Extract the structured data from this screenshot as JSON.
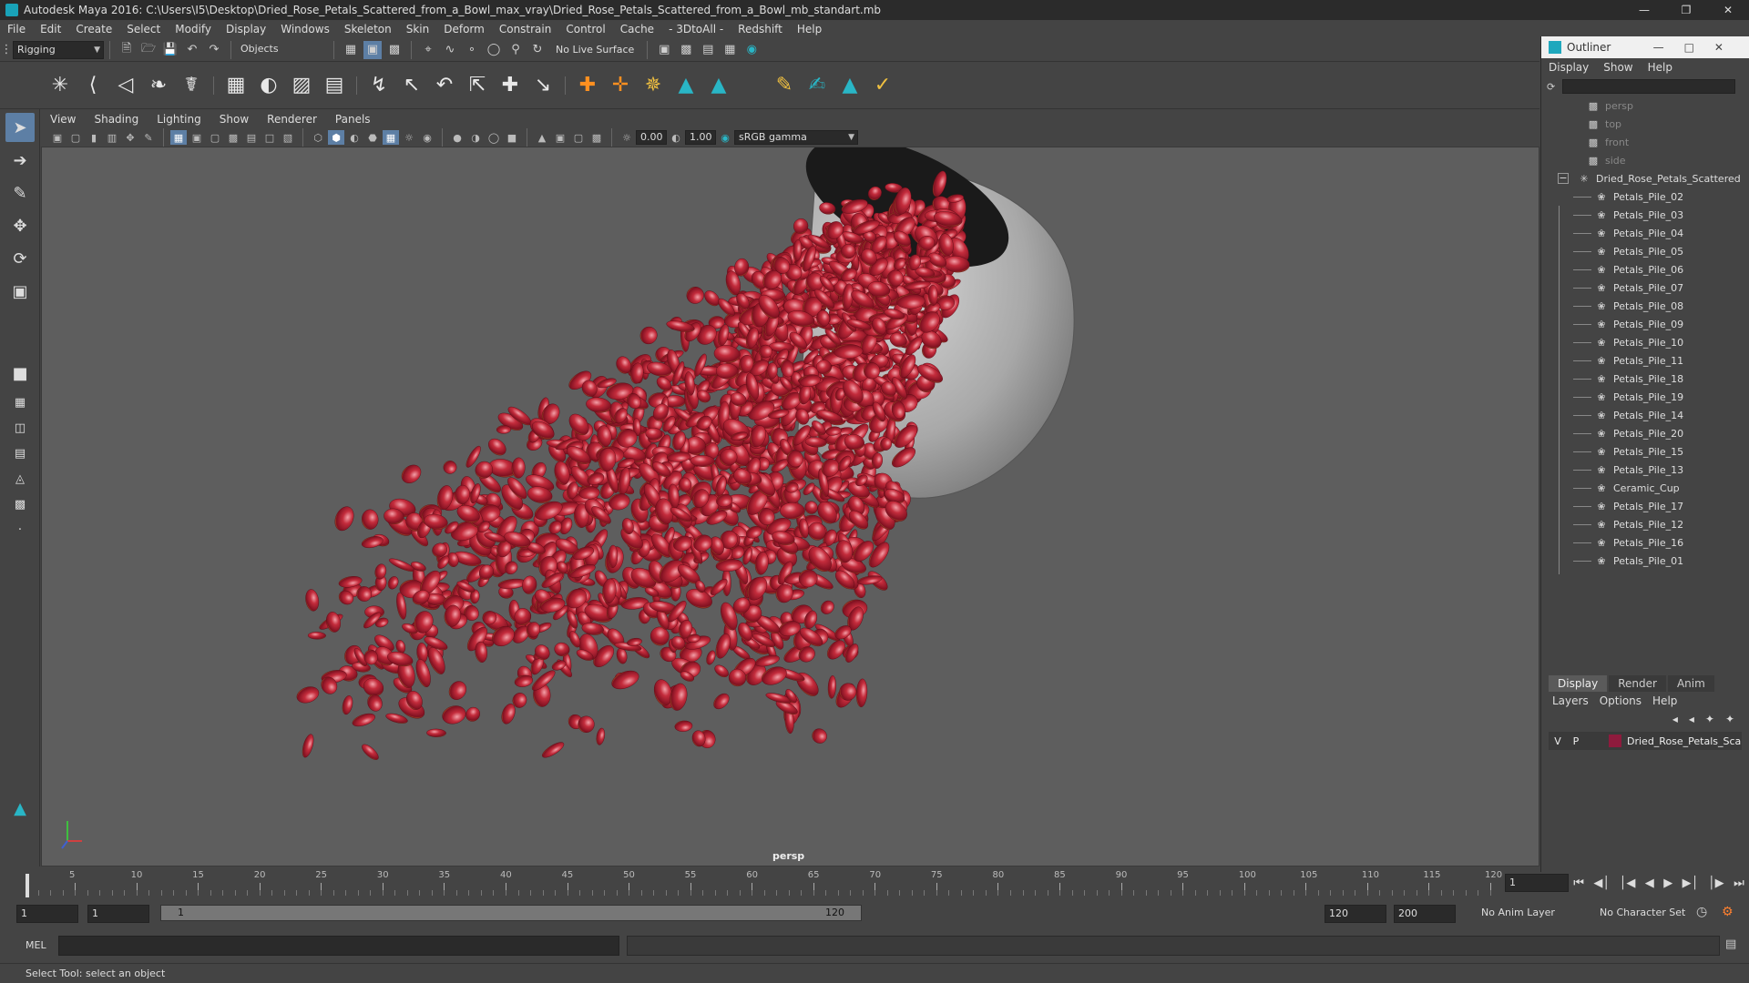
{
  "title_bar": {
    "text": "Autodesk Maya 2016: C:\\Users\\I5\\Desktop\\Dried_Rose_Petals_Scattered_from_a_Bowl_max_vray\\Dried_Rose_Petals_Scattered_from_a_Bowl_mb_standart.mb"
  },
  "menu": [
    "File",
    "Edit",
    "Create",
    "Select",
    "Modify",
    "Display",
    "Windows",
    "Skeleton",
    "Skin",
    "Deform",
    "Constrain",
    "Control",
    "Cache",
    "- 3DtoAll -",
    "Redshift",
    "Help"
  ],
  "status_line": {
    "mode": "Rigging",
    "selection_mask": "Objects",
    "live_surface": "No Live Surface"
  },
  "viewport": {
    "menu": [
      "View",
      "Shading",
      "Lighting",
      "Show",
      "Renderer",
      "Panels"
    ],
    "exposure": "0.00",
    "gamma": "1.00",
    "color_space": "sRGB gamma",
    "camera_label": "persp"
  },
  "outliner": {
    "title": "Outliner",
    "menu": [
      "Display",
      "Show",
      "Help"
    ],
    "cameras": [
      "persp",
      "top",
      "front",
      "side"
    ],
    "group": "Dried_Rose_Petals_Scattered",
    "children": [
      "Petals_Pile_02",
      "Petals_Pile_03",
      "Petals_Pile_04",
      "Petals_Pile_05",
      "Petals_Pile_06",
      "Petals_Pile_07",
      "Petals_Pile_08",
      "Petals_Pile_09",
      "Petals_Pile_10",
      "Petals_Pile_11",
      "Petals_Pile_18",
      "Petals_Pile_19",
      "Petals_Pile_14",
      "Petals_Pile_20",
      "Petals_Pile_15",
      "Petals_Pile_13",
      "Ceramic_Cup",
      "Petals_Pile_17",
      "Petals_Pile_12",
      "Petals_Pile_16",
      "Petals_Pile_01"
    ]
  },
  "layer_editor": {
    "tabs": [
      "Display",
      "Render",
      "Anim"
    ],
    "menu": [
      "Layers",
      "Options",
      "Help"
    ],
    "layer": {
      "v": "V",
      "p": "P",
      "name": "Dried_Rose_Petals_Sca",
      "color": "#8e1b3d"
    }
  },
  "timeline": {
    "ticks": [
      "1",
      "5",
      "10",
      "15",
      "20",
      "25",
      "30",
      "35",
      "40",
      "45",
      "50",
      "55",
      "60",
      "65",
      "70",
      "75",
      "80",
      "85",
      "90",
      "95",
      "100",
      "105",
      "110",
      "115",
      "120"
    ],
    "current_frame": "1"
  },
  "range": {
    "start": "1",
    "playback_start": "1",
    "slider_start": "1",
    "slider_end": "120",
    "playback_end": "120",
    "end": "200",
    "anim_layer": "No Anim Layer",
    "character_set": "No Character Set"
  },
  "command_line": {
    "label": "MEL"
  },
  "help_line": {
    "text": "Select Tool: select an object"
  }
}
